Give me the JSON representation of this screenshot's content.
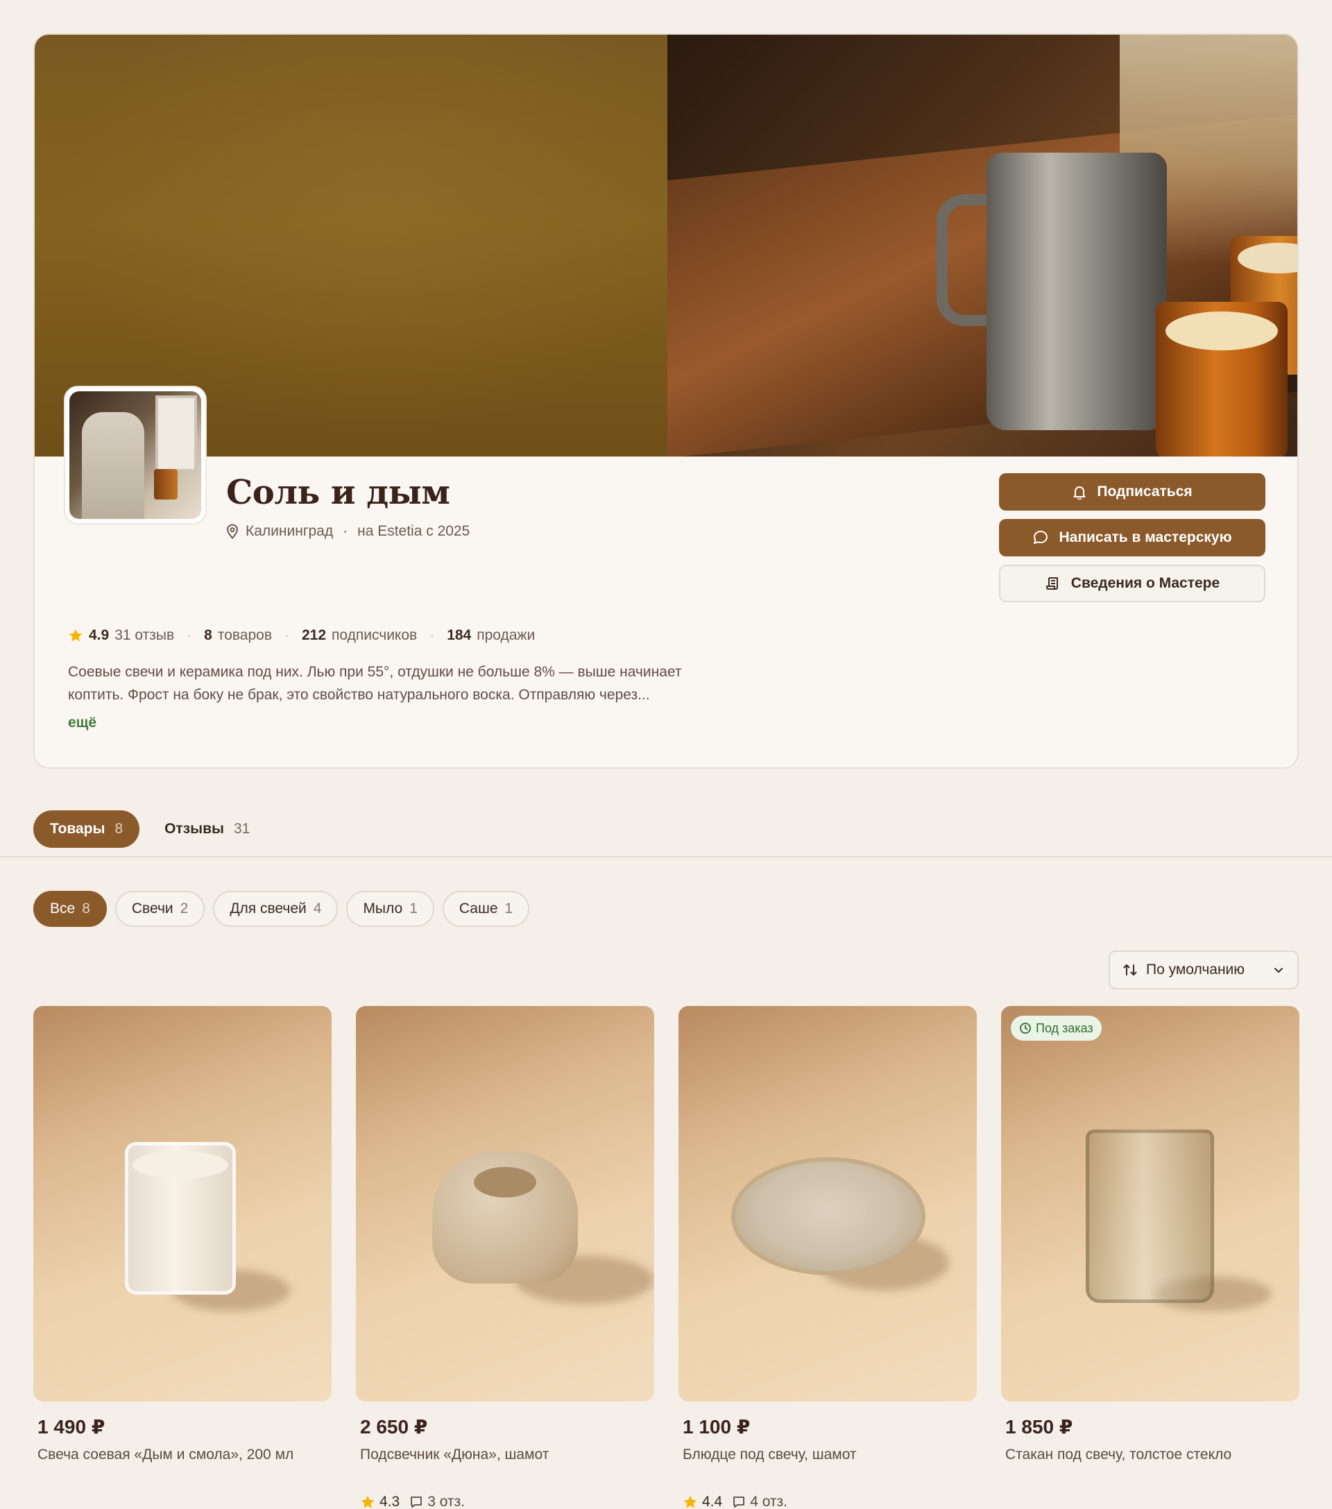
{
  "colors": {
    "accent": "#8b5a2b",
    "background": "#f4f0e9",
    "card": "#faf7f3",
    "link_green": "#3f7a3a",
    "star": "#f4b400"
  },
  "shop": {
    "title": "Соль и дым",
    "city": "Калининград",
    "separator": "·",
    "since": "на Estetia с 2025",
    "buttons": {
      "subscribe": "Подписаться",
      "message": "Написать в мастерскую",
      "about": "Сведения о Мастере"
    },
    "stats": {
      "rating": "4.9",
      "reviews": "31 отзыв",
      "products_count": "8",
      "products_label": "товаров",
      "subscribers_count": "212",
      "subscribers_label": "подписчиков",
      "sales_count": "184",
      "sales_label": "продажи"
    },
    "bio_line1": "Соевые свечи и керамика под них. Лью при 55°, отдушки не больше 8% — выше начинает",
    "bio_line2": "коптить. Фрост на боку не брак, это свойство натурального воска. Отправляю через...",
    "more": "ещё"
  },
  "tabs": [
    {
      "label": "Товары",
      "count": "8",
      "active": true
    },
    {
      "label": "Отзывы",
      "count": "31",
      "active": false
    }
  ],
  "filters": [
    {
      "label": "Все",
      "count": "8",
      "active": true
    },
    {
      "label": "Свечи",
      "count": "2",
      "active": false
    },
    {
      "label": "Для свечей",
      "count": "4",
      "active": false
    },
    {
      "label": "Мыло",
      "count": "1",
      "active": false
    },
    {
      "label": "Саше",
      "count": "1",
      "active": false
    }
  ],
  "sort": {
    "label": "По умолчанию"
  },
  "products": [
    {
      "price": "1 490 ₽",
      "name": "Свеча соевая «Дым и смола», 200 мл"
    },
    {
      "price": "2 650 ₽",
      "name": "Подсвечник «Дюна», шамот",
      "rating": "4.3",
      "reviews": "3 отз."
    },
    {
      "price": "1 100 ₽",
      "name": "Блюдце под свечу, шамот",
      "rating": "4.4",
      "reviews": "4 отз."
    },
    {
      "price": "1 850 ₽",
      "name": "Стакан под свечу, толстое стекло",
      "badge": "Под заказ"
    }
  ]
}
